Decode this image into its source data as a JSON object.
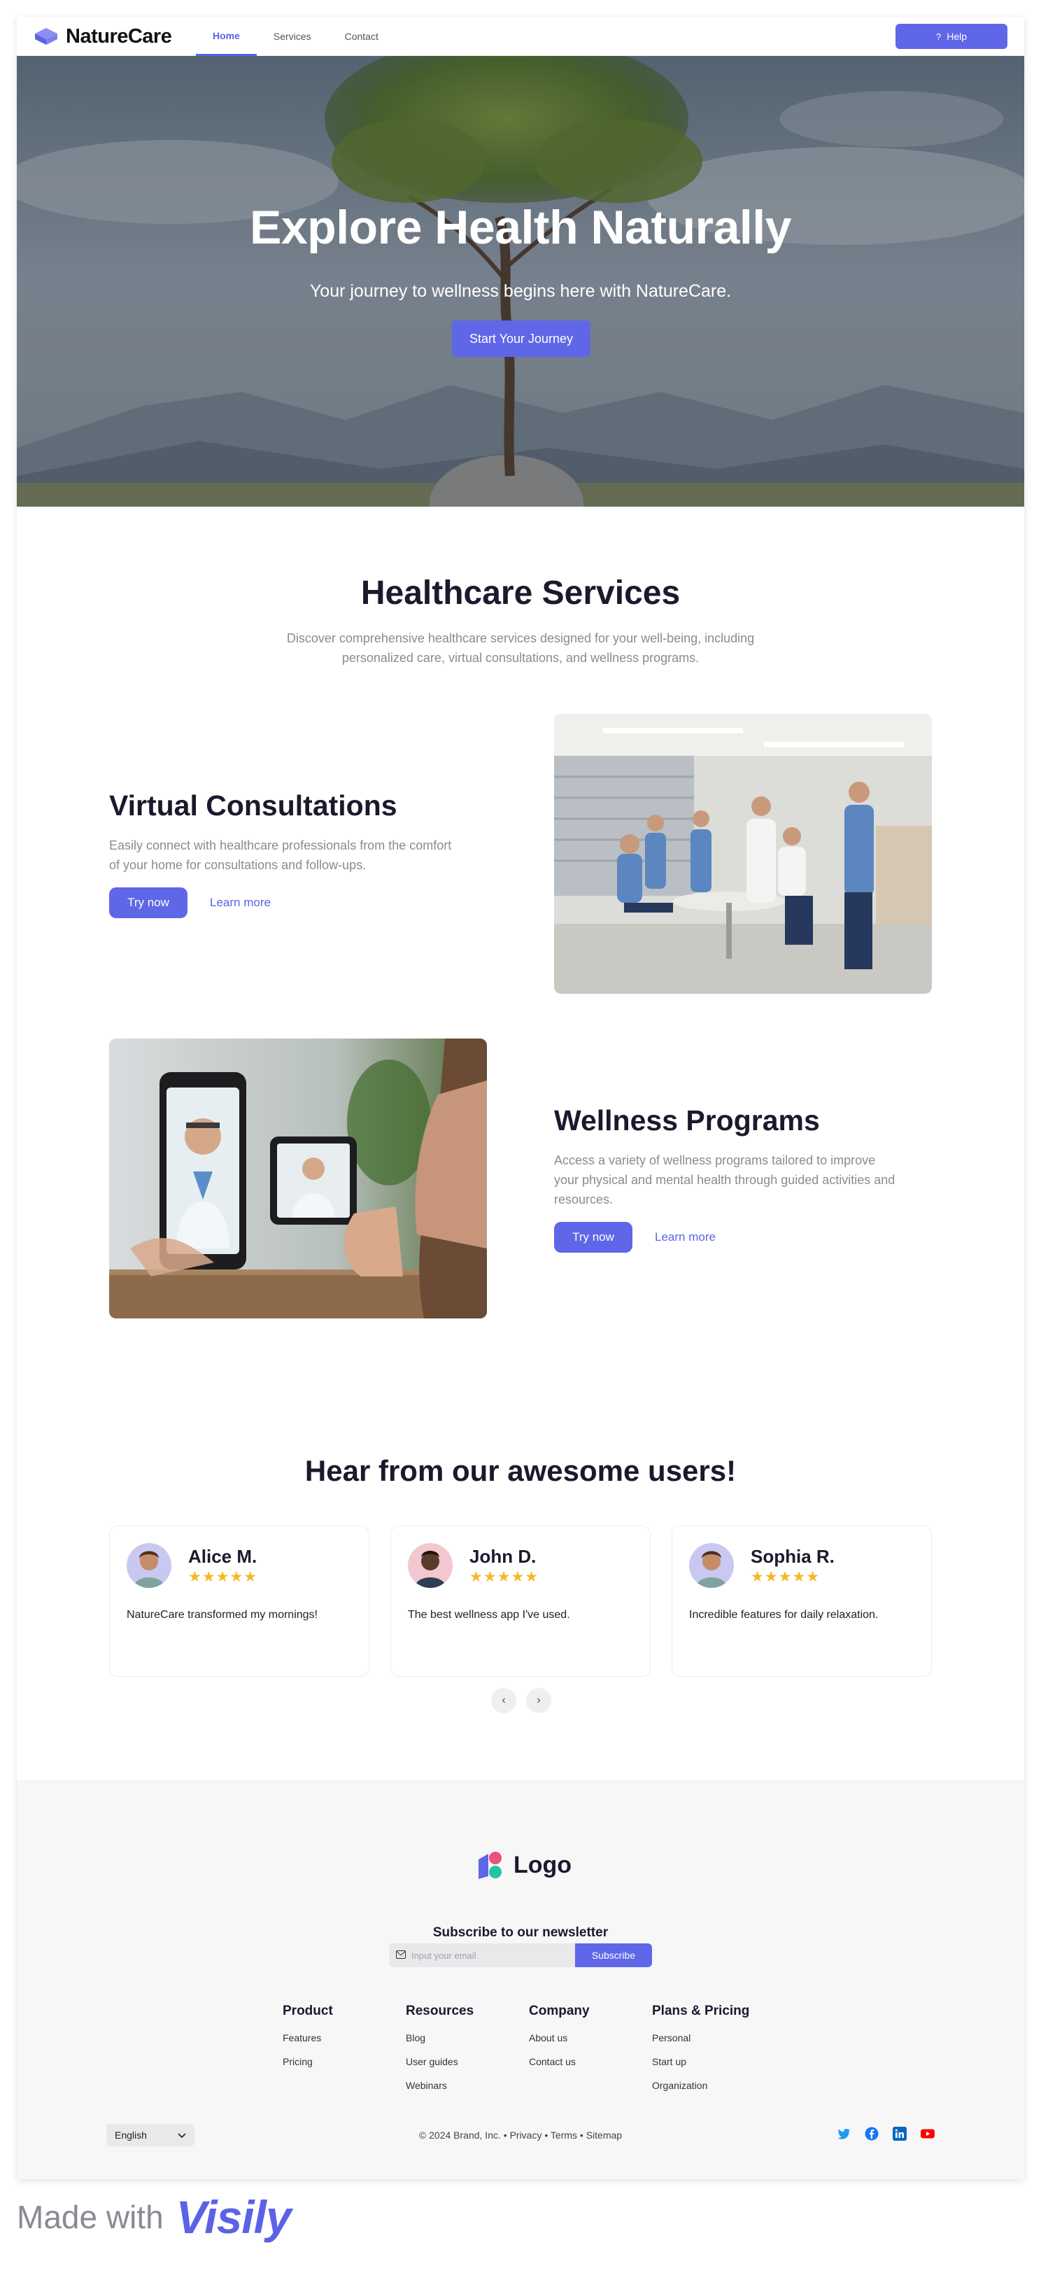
{
  "brand": {
    "name": "NatureCare",
    "accent": "#6066e8"
  },
  "nav": {
    "links": [
      "Home",
      "Services",
      "Contact"
    ],
    "active": "Home",
    "help_label": "Help",
    "help_icon": "question-icon"
  },
  "hero": {
    "title": "Explore Health Naturally",
    "subtitle": "Your journey to wellness begins here with NatureCare.",
    "cta": "Start Your Journey"
  },
  "services": {
    "title": "Healthcare Services",
    "description": "Discover comprehensive healthcare services designed for your well-being, including personalized care, virtual consultations, and wellness programs.",
    "features": [
      {
        "title": "Virtual Consultations",
        "description": "Easily connect with healthcare professionals from the comfort of your home for consultations and follow-ups.",
        "primary": "Try now",
        "secondary": "Learn more"
      },
      {
        "title": "Wellness Programs",
        "description": "Access a variety of wellness programs tailored to improve your physical and mental health through guided activities and resources.",
        "primary": "Try now",
        "secondary": "Learn more"
      }
    ]
  },
  "testimonials": {
    "title": "Hear from our awesome users!",
    "items": [
      {
        "name": "Alice M.",
        "stars": "★★★★★",
        "rating": 5,
        "text": "NatureCare transformed my mornings!"
      },
      {
        "name": "John D.",
        "stars": "★★★★★",
        "rating": 5,
        "text": "The best wellness app I've used."
      },
      {
        "name": "Sophia R.",
        "stars": "★★★★★",
        "rating": 5,
        "text": "Incredible features for daily relaxation."
      }
    ],
    "prev_icon": "chevron-left-icon",
    "next_icon": "chevron-right-icon"
  },
  "footer": {
    "logo_text": "Logo",
    "newsletter_title": "Subscribe to our newsletter",
    "email_placeholder": "Input your email",
    "subscribe_label": "Subscribe",
    "columns": [
      {
        "title": "Product",
        "items": [
          "Features",
          "Pricing"
        ]
      },
      {
        "title": "Resources",
        "items": [
          "Blog",
          "User guides",
          "Webinars"
        ]
      },
      {
        "title": "Company",
        "items": [
          "About us",
          "Contact us"
        ]
      },
      {
        "title": "Plans & Pricing",
        "items": [
          "Personal",
          "Start up",
          "Organization"
        ]
      }
    ],
    "language": "English",
    "copyright": "© 2024 Brand, Inc.",
    "legal_links": [
      "Privacy",
      "Terms",
      "Sitemap"
    ],
    "social": [
      "twitter-icon",
      "facebook-icon",
      "linkedin-icon",
      "youtube-icon"
    ]
  },
  "made_with": {
    "prefix": "Made with",
    "brand": "Visily"
  }
}
